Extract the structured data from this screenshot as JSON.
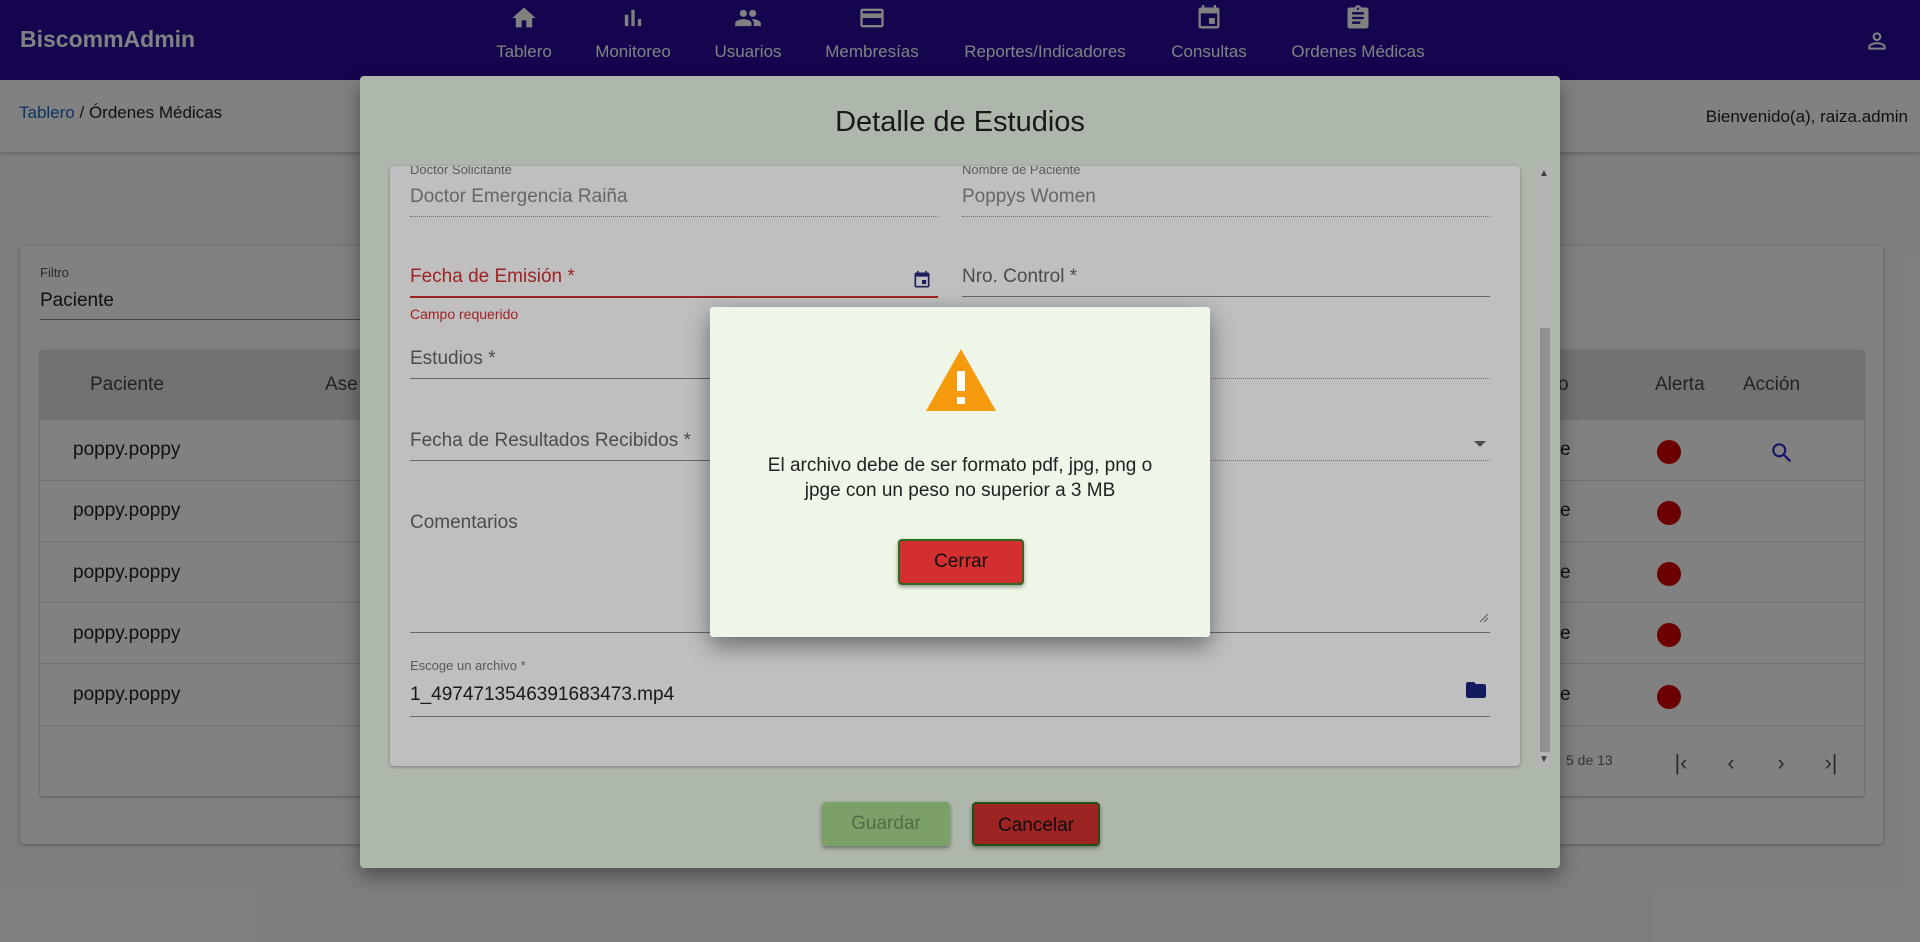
{
  "app": {
    "brand": "BiscommAdmin"
  },
  "nav": [
    {
      "label": "Tablero",
      "icon": "home-icon"
    },
    {
      "label": "Monitoreo",
      "icon": "bar-chart-icon"
    },
    {
      "label": "Usuarios",
      "icon": "people-icon"
    },
    {
      "label": "Membresías",
      "icon": "credit-card-icon"
    },
    {
      "label": "Reportes/Indicadores",
      "icon": "none"
    },
    {
      "label": "Consultas",
      "icon": "calendar-icon"
    },
    {
      "label": "Ordenes Médicas",
      "icon": "clipboard-icon"
    }
  ],
  "breadcrumb": {
    "root": "Tablero",
    "separator": " / ",
    "current": "Órdenes Médicas"
  },
  "welcome": "Bienvenido(a), raiza.admin",
  "filter": {
    "label": "Filtro",
    "value": "Paciente"
  },
  "table": {
    "headers": {
      "patient": "Paciente",
      "insurer": "Ase",
      "status_tail": "o",
      "alert": "Alerta",
      "action": "Acción"
    },
    "rows": [
      {
        "patient": "poppy.poppy",
        "tail": "e"
      },
      {
        "patient": "poppy.poppy",
        "tail": "e"
      },
      {
        "patient": "poppy.poppy",
        "tail": "e"
      },
      {
        "patient": "poppy.poppy",
        "tail": "e"
      },
      {
        "patient": "poppy.poppy",
        "tail": "e"
      }
    ],
    "pager": "5 de 13"
  },
  "dialog": {
    "title": "Detalle de Estudios",
    "doctor_label": "Doctor Solicitante",
    "doctor_value": "Doctor Emergencia Raiña",
    "patient_label": "Nombre de Paciente",
    "patient_value": "Poppys Women",
    "fecha_emision_label": "Fecha de Emisión *",
    "fecha_emision_error": "Campo requerido",
    "nro_control_label": "Nro. Control *",
    "estudios_label": "Estudios *",
    "fecha_resultados_label": "Fecha de Resultados Recibidos *",
    "comentarios_label": "Comentarios",
    "file_label": "Escoge un archivo *",
    "file_value": "1_4974713546391683473.mp4",
    "save_label": "Guardar",
    "cancel_label": "Cancelar"
  },
  "alert": {
    "message": "El archivo debe de ser formato pdf, jpg, png o jpge con un peso no superior a 3 MB",
    "close_label": "Cerrar",
    "warn_color": "#f59a0c"
  },
  "colors": {
    "topbar": "#2a0b9c",
    "danger": "#d32f2f",
    "save": "#a5d68b",
    "link": "#1565c0"
  }
}
